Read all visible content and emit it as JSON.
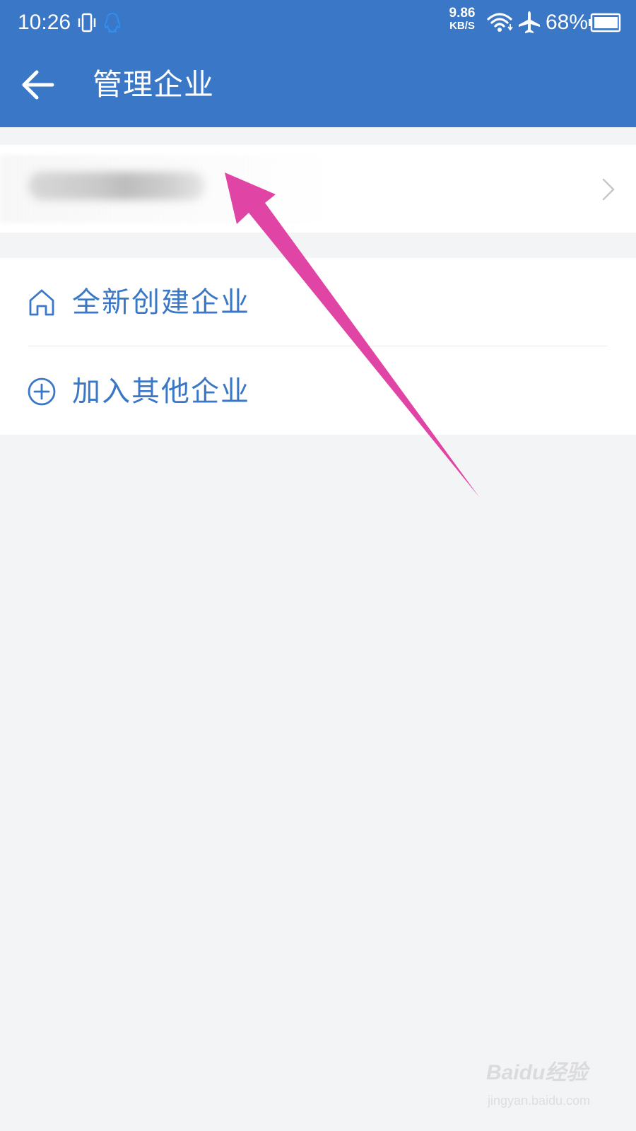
{
  "status_bar": {
    "time": "10:26",
    "net_speed_value": "9.86",
    "net_speed_unit": "KB/S",
    "battery": "68%",
    "icons": [
      "vibrate-icon",
      "qq-icon",
      "wifi-icon",
      "airplane-icon",
      "battery-icon"
    ]
  },
  "header": {
    "title": "管理企业",
    "back_icon": "arrow-left-icon"
  },
  "company": {
    "name_blurred": true,
    "chevron_icon": "chevron-right-icon"
  },
  "options": [
    {
      "label": "全新创建企业",
      "icon": "home-icon"
    },
    {
      "label": "加入其他企业",
      "icon": "plus-circle-icon"
    }
  ],
  "annotation": {
    "arrow_color": "#e044a4"
  },
  "watermark": {
    "logo": "Baidu经验",
    "url": "jingyan.baidu.com"
  },
  "colors": {
    "header_bg": "#3a77c6",
    "accent_text": "#3a77c6",
    "page_bg": "#f3f4f6"
  }
}
